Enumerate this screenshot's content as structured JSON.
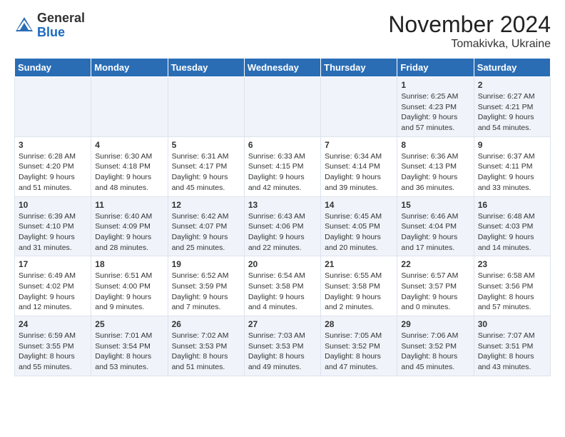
{
  "header": {
    "logo_general": "General",
    "logo_blue": "Blue",
    "month_title": "November 2024",
    "location": "Tomakivka, Ukraine"
  },
  "days_of_week": [
    "Sunday",
    "Monday",
    "Tuesday",
    "Wednesday",
    "Thursday",
    "Friday",
    "Saturday"
  ],
  "rows": [
    [
      {
        "num": "",
        "info": ""
      },
      {
        "num": "",
        "info": ""
      },
      {
        "num": "",
        "info": ""
      },
      {
        "num": "",
        "info": ""
      },
      {
        "num": "",
        "info": ""
      },
      {
        "num": "1",
        "info": "Sunrise: 6:25 AM\nSunset: 4:23 PM\nDaylight: 9 hours and 57 minutes."
      },
      {
        "num": "2",
        "info": "Sunrise: 6:27 AM\nSunset: 4:21 PM\nDaylight: 9 hours and 54 minutes."
      }
    ],
    [
      {
        "num": "3",
        "info": "Sunrise: 6:28 AM\nSunset: 4:20 PM\nDaylight: 9 hours and 51 minutes."
      },
      {
        "num": "4",
        "info": "Sunrise: 6:30 AM\nSunset: 4:18 PM\nDaylight: 9 hours and 48 minutes."
      },
      {
        "num": "5",
        "info": "Sunrise: 6:31 AM\nSunset: 4:17 PM\nDaylight: 9 hours and 45 minutes."
      },
      {
        "num": "6",
        "info": "Sunrise: 6:33 AM\nSunset: 4:15 PM\nDaylight: 9 hours and 42 minutes."
      },
      {
        "num": "7",
        "info": "Sunrise: 6:34 AM\nSunset: 4:14 PM\nDaylight: 9 hours and 39 minutes."
      },
      {
        "num": "8",
        "info": "Sunrise: 6:36 AM\nSunset: 4:13 PM\nDaylight: 9 hours and 36 minutes."
      },
      {
        "num": "9",
        "info": "Sunrise: 6:37 AM\nSunset: 4:11 PM\nDaylight: 9 hours and 33 minutes."
      }
    ],
    [
      {
        "num": "10",
        "info": "Sunrise: 6:39 AM\nSunset: 4:10 PM\nDaylight: 9 hours and 31 minutes."
      },
      {
        "num": "11",
        "info": "Sunrise: 6:40 AM\nSunset: 4:09 PM\nDaylight: 9 hours and 28 minutes."
      },
      {
        "num": "12",
        "info": "Sunrise: 6:42 AM\nSunset: 4:07 PM\nDaylight: 9 hours and 25 minutes."
      },
      {
        "num": "13",
        "info": "Sunrise: 6:43 AM\nSunset: 4:06 PM\nDaylight: 9 hours and 22 minutes."
      },
      {
        "num": "14",
        "info": "Sunrise: 6:45 AM\nSunset: 4:05 PM\nDaylight: 9 hours and 20 minutes."
      },
      {
        "num": "15",
        "info": "Sunrise: 6:46 AM\nSunset: 4:04 PM\nDaylight: 9 hours and 17 minutes."
      },
      {
        "num": "16",
        "info": "Sunrise: 6:48 AM\nSunset: 4:03 PM\nDaylight: 9 hours and 14 minutes."
      }
    ],
    [
      {
        "num": "17",
        "info": "Sunrise: 6:49 AM\nSunset: 4:02 PM\nDaylight: 9 hours and 12 minutes."
      },
      {
        "num": "18",
        "info": "Sunrise: 6:51 AM\nSunset: 4:00 PM\nDaylight: 9 hours and 9 minutes."
      },
      {
        "num": "19",
        "info": "Sunrise: 6:52 AM\nSunset: 3:59 PM\nDaylight: 9 hours and 7 minutes."
      },
      {
        "num": "20",
        "info": "Sunrise: 6:54 AM\nSunset: 3:58 PM\nDaylight: 9 hours and 4 minutes."
      },
      {
        "num": "21",
        "info": "Sunrise: 6:55 AM\nSunset: 3:58 PM\nDaylight: 9 hours and 2 minutes."
      },
      {
        "num": "22",
        "info": "Sunrise: 6:57 AM\nSunset: 3:57 PM\nDaylight: 9 hours and 0 minutes."
      },
      {
        "num": "23",
        "info": "Sunrise: 6:58 AM\nSunset: 3:56 PM\nDaylight: 8 hours and 57 minutes."
      }
    ],
    [
      {
        "num": "24",
        "info": "Sunrise: 6:59 AM\nSunset: 3:55 PM\nDaylight: 8 hours and 55 minutes."
      },
      {
        "num": "25",
        "info": "Sunrise: 7:01 AM\nSunset: 3:54 PM\nDaylight: 8 hours and 53 minutes."
      },
      {
        "num": "26",
        "info": "Sunrise: 7:02 AM\nSunset: 3:53 PM\nDaylight: 8 hours and 51 minutes."
      },
      {
        "num": "27",
        "info": "Sunrise: 7:03 AM\nSunset: 3:53 PM\nDaylight: 8 hours and 49 minutes."
      },
      {
        "num": "28",
        "info": "Sunrise: 7:05 AM\nSunset: 3:52 PM\nDaylight: 8 hours and 47 minutes."
      },
      {
        "num": "29",
        "info": "Sunrise: 7:06 AM\nSunset: 3:52 PM\nDaylight: 8 hours and 45 minutes."
      },
      {
        "num": "30",
        "info": "Sunrise: 7:07 AM\nSunset: 3:51 PM\nDaylight: 8 hours and 43 minutes."
      }
    ]
  ]
}
